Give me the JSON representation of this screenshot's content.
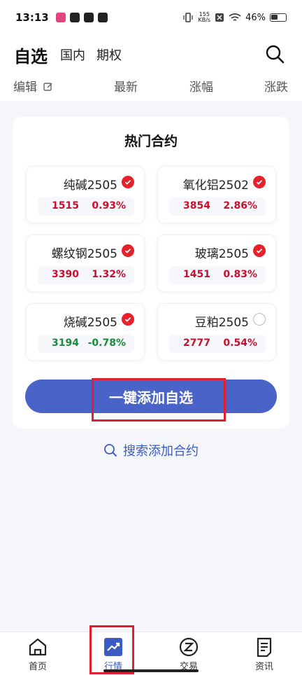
{
  "status_bar": {
    "time": "13:13",
    "net_speed_value": "155",
    "net_speed_unit": "KB/s",
    "battery": "46%"
  },
  "header": {
    "title": "自选",
    "tabs": [
      "国内",
      "期权"
    ],
    "columns": {
      "edit": "编辑",
      "latest": "最新",
      "change_pct": "涨幅",
      "change": "涨跌"
    }
  },
  "hot": {
    "title": "热门合约",
    "contracts": [
      {
        "name": "纯碱2505",
        "price": "1515",
        "pct": "0.93%",
        "checked": true
      },
      {
        "name": "氧化铝2502",
        "price": "3854",
        "pct": "2.86%",
        "checked": true
      },
      {
        "name": "螺纹钢2505",
        "price": "3390",
        "pct": "1.32%",
        "checked": true
      },
      {
        "name": "玻璃2505",
        "price": "1451",
        "pct": "0.83%",
        "checked": true
      },
      {
        "name": "烧碱2505",
        "price": "3194",
        "pct": "-0.78%",
        "checked": true
      },
      {
        "name": "豆粕2505",
        "price": "2777",
        "pct": "0.54%",
        "checked": false
      }
    ],
    "add_all_label": "一键添加自选"
  },
  "search_add_label": "搜索添加合约",
  "nav": {
    "home": "首页",
    "market": "行情",
    "trade": "交易",
    "news": "资讯"
  },
  "colors": {
    "accent": "#4a63c8",
    "up": "#c8102e",
    "down": "#1a8a3c",
    "check": "#e8202a"
  }
}
